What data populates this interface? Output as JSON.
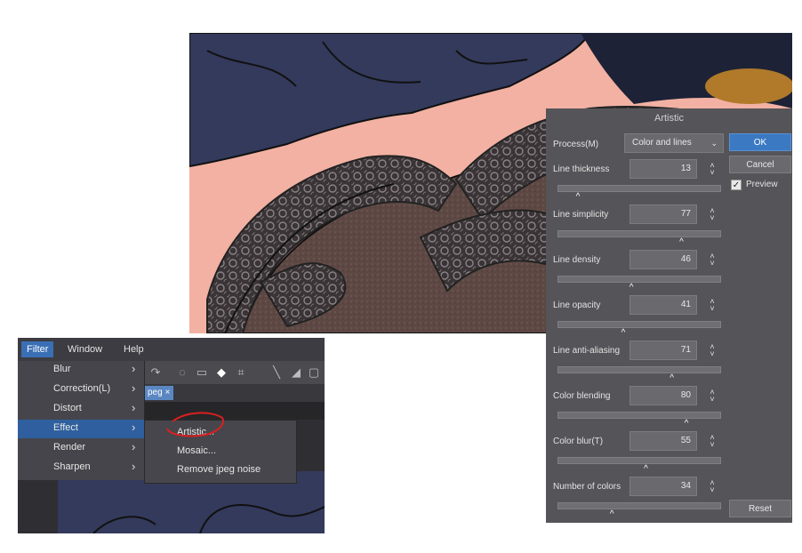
{
  "menubar": {
    "filter": "Filter",
    "window": "Window",
    "help": "Help"
  },
  "filter_menu": [
    {
      "label": "Blur"
    },
    {
      "label": "Correction(L)"
    },
    {
      "label": "Distort"
    },
    {
      "label": "Effect"
    },
    {
      "label": "Render"
    },
    {
      "label": "Sharpen"
    }
  ],
  "effect_submenu": [
    "Artistic...",
    "Mosaic...",
    "Remove jpeg noise"
  ],
  "file_tab": "peg ×",
  "dialog": {
    "title": "Artistic",
    "process_label": "Process(M)",
    "process_value": "Color and lines",
    "ok": "OK",
    "cancel": "Cancel",
    "preview": "Preview",
    "preview_checked": true,
    "reset": "Reset",
    "params": [
      {
        "label": "Line thickness",
        "value": "13",
        "fraction": 0.13
      },
      {
        "label": "Line simplicity",
        "value": "77",
        "fraction": 0.77
      },
      {
        "label": "Line density",
        "value": "46",
        "fraction": 0.46
      },
      {
        "label": "Line opacity",
        "value": "41",
        "fraction": 0.41
      },
      {
        "label": "Line anti-aliasing",
        "value": "71",
        "fraction": 0.71
      },
      {
        "label": "Color blending",
        "value": "80",
        "fraction": 0.8
      },
      {
        "label": "Color blur(T)",
        "value": "55",
        "fraction": 0.55
      },
      {
        "label": "Number of colors",
        "value": "34",
        "fraction": 0.34
      }
    ]
  },
  "colors": {
    "accent": "#3b79c3",
    "menu_highlight": "#2f5f9e",
    "annotation": "#d82020"
  }
}
